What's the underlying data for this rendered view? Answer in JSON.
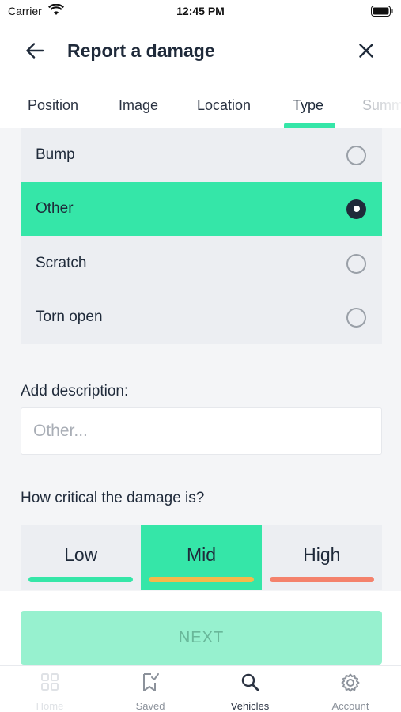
{
  "status_bar": {
    "carrier": "Carrier",
    "time": "12:45 PM"
  },
  "header": {
    "title": "Report a damage",
    "back_icon": "arrow-left-icon",
    "close_icon": "close-icon"
  },
  "tabs": [
    {
      "label": "Position"
    },
    {
      "label": "Image"
    },
    {
      "label": "Location"
    },
    {
      "label": "Type",
      "active": true
    },
    {
      "label": "Summ"
    }
  ],
  "damage_types": [
    {
      "label": "Bump",
      "selected": false
    },
    {
      "label": "Other",
      "selected": true
    },
    {
      "label": "Scratch",
      "selected": false
    },
    {
      "label": "Torn open",
      "selected": false
    }
  ],
  "description": {
    "label": "Add description:",
    "placeholder": "Other...",
    "value": ""
  },
  "criticality": {
    "label": "How critical the damage is?",
    "options": [
      {
        "label": "Low",
        "color": "#35e6a8",
        "selected": false
      },
      {
        "label": "Mid",
        "color": "#f5b94a",
        "selected": true
      },
      {
        "label": "High",
        "color": "#f4826c",
        "selected": false
      }
    ]
  },
  "next_button": {
    "label": "NEXT",
    "enabled": false
  },
  "bottom_nav": [
    {
      "label": "Home",
      "icon": "grid-icon",
      "state": "disabled"
    },
    {
      "label": "Saved",
      "icon": "bookmark-check-icon",
      "state": "normal"
    },
    {
      "label": "Vehicles",
      "icon": "search-icon",
      "state": "active"
    },
    {
      "label": "Account",
      "icon": "gear-icon",
      "state": "normal"
    }
  ],
  "colors": {
    "accent": "#35e6a8",
    "accent_disabled": "#97f1cf",
    "text_dark": "#1f2a3a"
  }
}
